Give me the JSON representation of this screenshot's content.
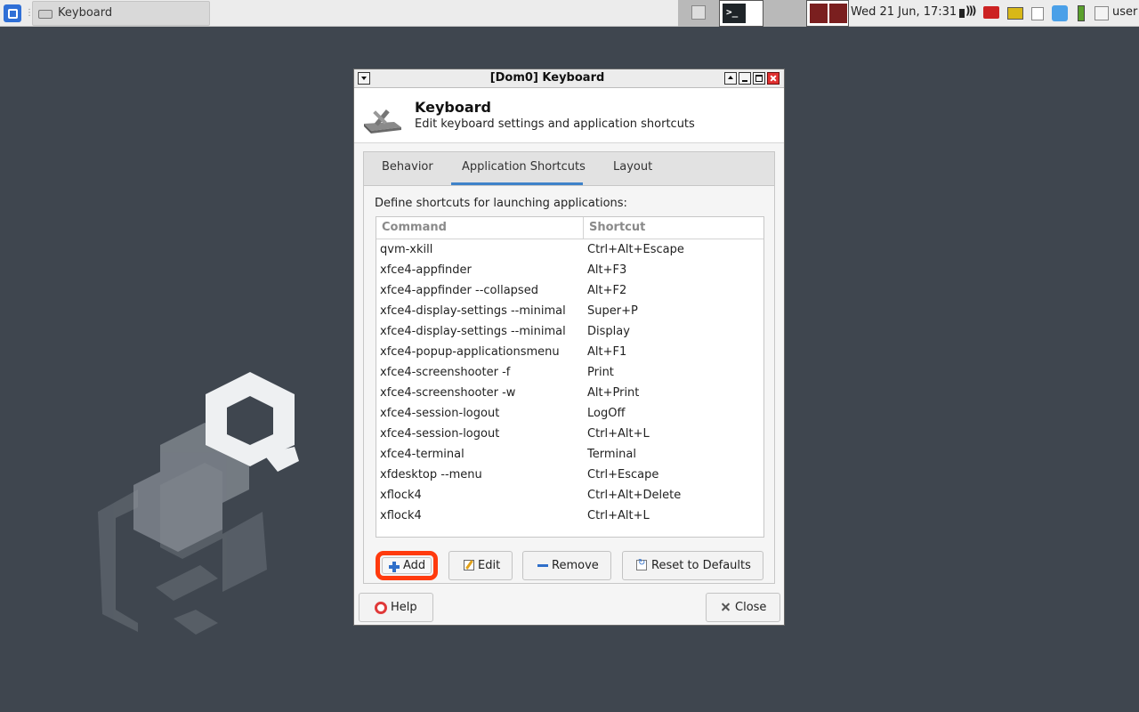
{
  "panel": {
    "task_title": "Keyboard",
    "clock": "Wed 21 Jun, 17:31",
    "user": "user",
    "tray_icons": [
      "volume-icon",
      "network-icon",
      "display-icon",
      "clipboard-icon",
      "qubes-domains-icon",
      "battery-icon",
      "disk-icon"
    ]
  },
  "window": {
    "title": "[Dom0] Keyboard",
    "header_title": "Keyboard",
    "header_subtitle": "Edit keyboard settings and application shortcuts",
    "tabs": [
      "Behavior",
      "Application Shortcuts",
      "Layout"
    ],
    "active_tab": "Application Shortcuts",
    "define_label": "Define shortcuts for launching applications:",
    "columns": {
      "command": "Command",
      "shortcut": "Shortcut"
    },
    "shortcuts": [
      {
        "command": "qvm-xkill",
        "shortcut": "Ctrl+Alt+Escape"
      },
      {
        "command": "xfce4-appfinder",
        "shortcut": "Alt+F3"
      },
      {
        "command": "xfce4-appfinder --collapsed",
        "shortcut": "Alt+F2"
      },
      {
        "command": "xfce4-display-settings --minimal",
        "shortcut": "Super+P"
      },
      {
        "command": "xfce4-display-settings --minimal",
        "shortcut": "Display"
      },
      {
        "command": "xfce4-popup-applicationsmenu",
        "shortcut": "Alt+F1"
      },
      {
        "command": "xfce4-screenshooter -f",
        "shortcut": "Print"
      },
      {
        "command": "xfce4-screenshooter -w",
        "shortcut": "Alt+Print"
      },
      {
        "command": "xfce4-session-logout",
        "shortcut": "LogOff"
      },
      {
        "command": "xfce4-session-logout",
        "shortcut": "Ctrl+Alt+L"
      },
      {
        "command": "xfce4-terminal",
        "shortcut": "Terminal"
      },
      {
        "command": "xfdesktop --menu",
        "shortcut": "Ctrl+Escape"
      },
      {
        "command": "xflock4",
        "shortcut": "Ctrl+Alt+Delete"
      },
      {
        "command": "xflock4",
        "shortcut": "Ctrl+Alt+L"
      }
    ],
    "buttons": {
      "add": "Add",
      "edit": "Edit",
      "remove": "Remove",
      "reset": "Reset to Defaults",
      "help": "Help",
      "close": "Close"
    },
    "highlight_color": "#ff3a0d",
    "accent_color": "#3e82c9"
  }
}
